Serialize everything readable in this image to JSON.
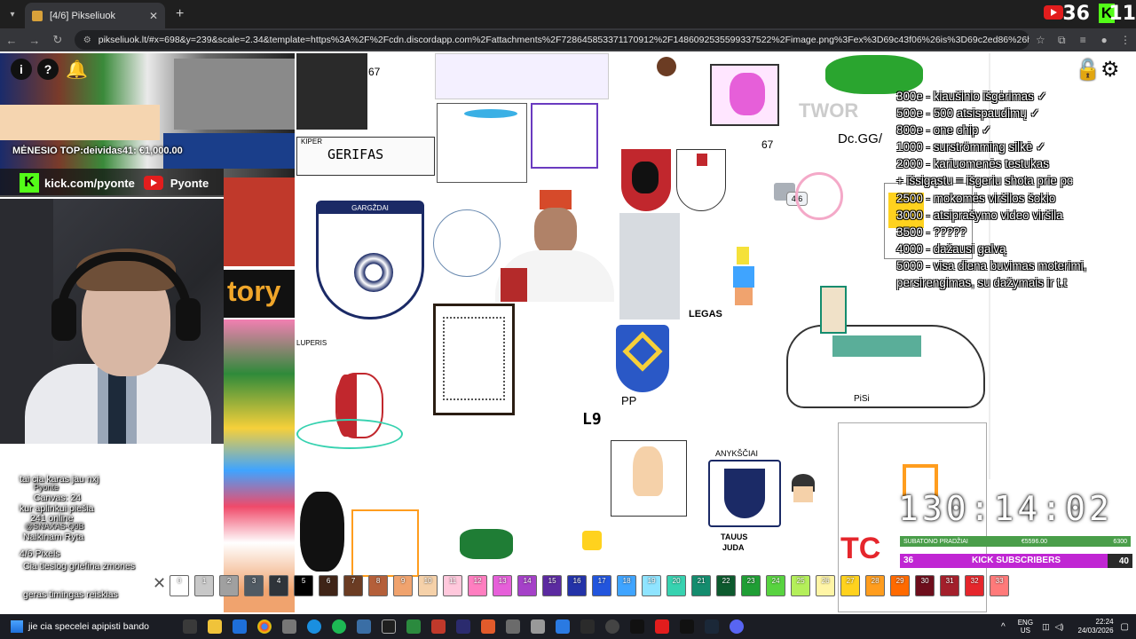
{
  "browser": {
    "tab_title": "[4/6] Pikseliuok",
    "url": "pikseliuok.lt/#x=698&y=239&scale=2.34&template=https%3A%2F%2Fcdn.discordapp.com%2Fattachments%2F728645853371170912%2F1486092535599337522%2Fimage.png%3Fex%3D69c43f06%26is%3D69c2ed86%26hm%3D279342bfa23cc773..."
  },
  "stream_counts": {
    "youtube_viewers": "36",
    "kick_viewers": "11"
  },
  "stream_overlay": {
    "kick_channel": "kick.com/pyonte",
    "youtube_channel": "Pyonte",
    "monthly_top": "MĖNESIO TOP:deividas41: €1,000.00",
    "goals": [
      "300e - kiaušinio išgėrimas ✓",
      "500e - 500 atsispaudimų ✓",
      "800e - one chip ✓",
      "1000 - surströmming silkė ✓",
      "2000 - kariuomenės testukas",
      "+ išsigąstu = išgeriu shota prie pc",
      "2500 - mokomės viršilos šokio",
      "3000 - atsiprašymo video viršila",
      "3500 - ?????",
      "4000 - dažausi galvą",
      "5000 - visa diena buvimas moterimi, persirengimas, su dažymais ir t.t"
    ],
    "timer": "130:14:02",
    "subathon_bar": {
      "label": "SUBATONO PRADŽIAI",
      "current": "€5596.00",
      "target": "6300"
    },
    "kick_subs": {
      "current": "36",
      "label": "KICK SUBSCRIBERS",
      "target": "40"
    }
  },
  "chat": [
    {
      "user": "",
      "text": "tai cia karas jau nxj",
      "dim": false
    },
    {
      "user": "",
      "text": "Pyonte",
      "dim": true
    },
    {
      "user": "",
      "text": "Canvas: 24",
      "dim": false
    },
    {
      "user": "",
      "text": "kur aplinkui piešia",
      "dim": false
    },
    {
      "user": "",
      "text": "241 online",
      "dim": false
    },
    {
      "user": "",
      "text": "@SNAXAS-Q9B",
      "dim": true
    },
    {
      "user": "",
      "text": "Naikinam Ryta",
      "dim": false
    },
    {
      "user": "",
      "text": "4/6 Pixels",
      "dim": false
    },
    {
      "user": "",
      "text": "Cia tiesiog griefina zmones",
      "dim": false
    },
    {
      "user": "",
      "text": "geras timingas reiskias",
      "dim": false
    },
    {
      "user": "",
      "text": "jie cia specelei apipisti bando",
      "dim": false
    }
  ],
  "canvas_labels": {
    "fourSix": "4/6",
    "dcgg": "Dc.GG/",
    "sixty_seven_a": "67",
    "sixty_seven_b": "67",
    "gerifas": "GERIFAS",
    "gargzdai": "GARGŽDAI",
    "story": "tory",
    "pp": "PP",
    "l9": "L9",
    "legas": "LEGAS",
    "anyksciai": "ANYKŠČIAI",
    "tauus": "TAUUS",
    "juda": "JUDA",
    "tc": "TC",
    "pisi": "PiSi",
    "lukpris": "LUPERIS",
    "kiper": "KIPER",
    "twor": "TWOR"
  },
  "palette": {
    "swatches": [
      {
        "n": "0",
        "c": "#ffffff"
      },
      {
        "n": "1",
        "c": "#c8c8c8"
      },
      {
        "n": "2",
        "c": "#a0a0a0"
      },
      {
        "n": "3",
        "c": "#505a63"
      },
      {
        "n": "4",
        "c": "#2f343a"
      },
      {
        "n": "5",
        "c": "#000000"
      },
      {
        "n": "6",
        "c": "#3f2417"
      },
      {
        "n": "7",
        "c": "#6b3c23"
      },
      {
        "n": "8",
        "c": "#b45f3a"
      },
      {
        "n": "9",
        "c": "#f0a36e"
      },
      {
        "n": "10",
        "c": "#f5d1a9"
      },
      {
        "n": "11",
        "c": "#ffc8dc"
      },
      {
        "n": "12",
        "c": "#ff7ec0"
      },
      {
        "n": "13",
        "c": "#e65fd9"
      },
      {
        "n": "14",
        "c": "#a541c8"
      },
      {
        "n": "15",
        "c": "#5b2aa0"
      },
      {
        "n": "16",
        "c": "#2433a8"
      },
      {
        "n": "17",
        "c": "#2255dd"
      },
      {
        "n": "18",
        "c": "#3fa4ff"
      },
      {
        "n": "19",
        "c": "#8fe4ff"
      },
      {
        "n": "20",
        "c": "#37d2b0"
      },
      {
        "n": "21",
        "c": "#148c6e"
      },
      {
        "n": "22",
        "c": "#0d5a2e"
      },
      {
        "n": "23",
        "c": "#1f9e35"
      },
      {
        "n": "24",
        "c": "#58d340"
      },
      {
        "n": "25",
        "c": "#b4ef5a"
      },
      {
        "n": "26",
        "c": "#fff5a6"
      },
      {
        "n": "27",
        "c": "#ffd21e"
      },
      {
        "n": "28",
        "c": "#ff9d1e"
      },
      {
        "n": "29",
        "c": "#ff6a00"
      },
      {
        "n": "30",
        "c": "#6e0e1c"
      },
      {
        "n": "31",
        "c": "#a31f2b"
      },
      {
        "n": "32",
        "c": "#e5262c"
      },
      {
        "n": "33",
        "c": "#ff7a7a"
      }
    ]
  },
  "taskbar": {
    "search_text": "jie cia specelei apipisti bando",
    "language_top": "ENG",
    "language_bottom": "US",
    "time": "22:24",
    "date": "24/03/2026"
  }
}
